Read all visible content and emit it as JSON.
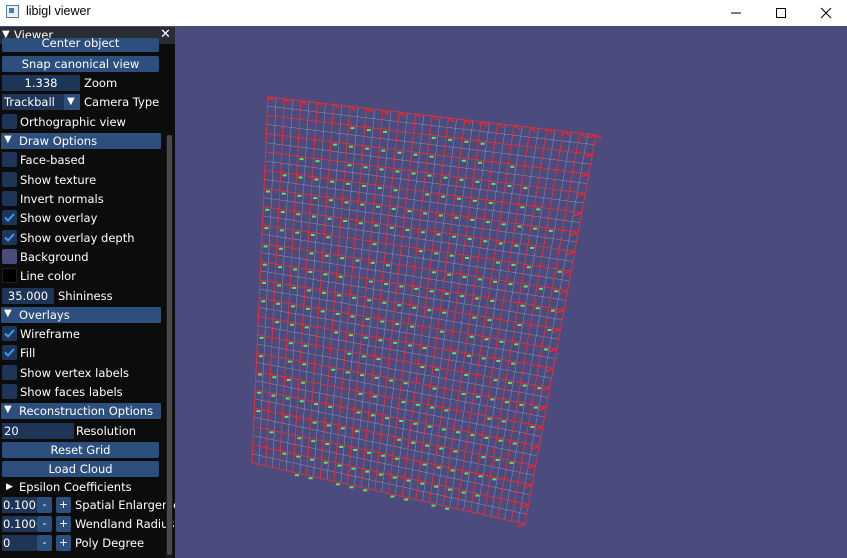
{
  "window": {
    "title": "libigl viewer"
  },
  "panel": {
    "title": "Viewer",
    "center_object": "Center object",
    "snap_canonical": "Snap canonical view",
    "zoom_value": "1.338",
    "zoom_label": "Zoom",
    "camera_value": "Trackball",
    "camera_label": "Camera Type",
    "orthographic": "Orthographic view",
    "draw_options": "Draw Options",
    "face_based": "Face-based",
    "show_texture": "Show texture",
    "invert_normals": "Invert normals",
    "show_overlay": "Show overlay",
    "show_overlay_depth": "Show overlay depth",
    "background": "Background",
    "line_color": "Line color",
    "shininess_value": "35.000",
    "shininess_label": "Shininess",
    "overlays": "Overlays",
    "wireframe": "Wireframe",
    "fill": "Fill",
    "show_vertex_labels": "Show vertex labels",
    "show_faces_labels": "Show faces labels",
    "reconstruction_options": "Reconstruction Options",
    "resolution_value": "20",
    "resolution_label": "Resolution",
    "reset_grid": "Reset Grid",
    "load_cloud": "Load Cloud",
    "epsilon_coefficients": "Epsilon Coefficients",
    "spatial_value": "0.100",
    "spatial_label": "Spatial Enlargeme",
    "wendland_value": "0.100(",
    "wendland_label": "Wendland Radius",
    "poly_value": "0",
    "poly_label": "Poly Degree",
    "minus": "-",
    "plus": "+"
  },
  "colors": {
    "viewport_bg": "#4b4b7e",
    "background_swatch": "#4b4b7e",
    "line_color_swatch": "#000000",
    "accent": "#2d4f7d",
    "wire": "#ff2020",
    "points": "#60ff60"
  }
}
